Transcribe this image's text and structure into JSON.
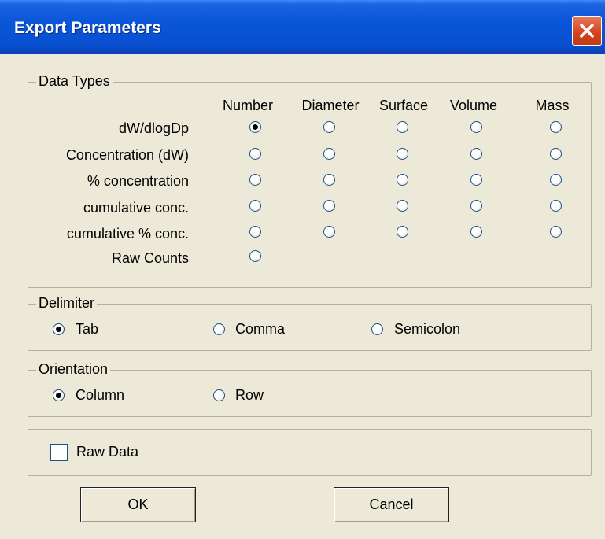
{
  "window": {
    "title": "Export Parameters"
  },
  "data_types": {
    "legend": "Data Types",
    "columns": [
      "Number",
      "Diameter",
      "Surface",
      "Volume",
      "Mass"
    ],
    "rows": [
      "dW/dlogDp",
      "Concentration (dW)",
      "% concentration",
      "cumulative conc.",
      "cumulative % conc.",
      "Raw Counts"
    ],
    "selected": "dW/dlogDp / Number"
  },
  "delimiter": {
    "legend": "Delimiter",
    "options": [
      "Tab",
      "Comma",
      "Semicolon"
    ],
    "selected": "Tab"
  },
  "orientation": {
    "legend": "Orientation",
    "options": [
      "Column",
      "Row"
    ],
    "selected": "Column"
  },
  "raw_data": {
    "label": "Raw Data",
    "checked": false
  },
  "buttons": {
    "ok": "OK",
    "cancel": "Cancel"
  }
}
